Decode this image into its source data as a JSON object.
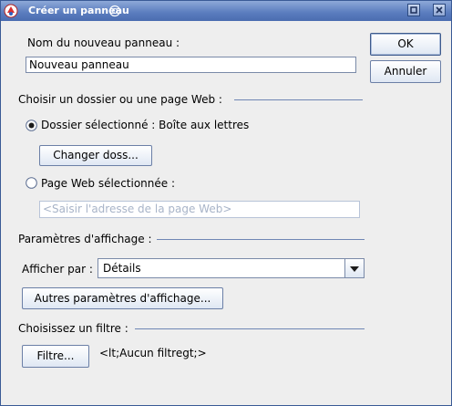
{
  "window": {
    "title": "Créer un panneau"
  },
  "name_section": {
    "label": "Nom du nouveau panneau :",
    "value": "Nouveau panneau"
  },
  "buttons": {
    "ok": "OK",
    "cancel": "Annuler"
  },
  "location_section": {
    "heading": "Choisir un dossier ou une page Web :",
    "folder_option": {
      "label": "Dossier sélectionné : Boîte aux lettres",
      "selected": true
    },
    "change_folder_button": "Changer doss...",
    "web_option": {
      "label": "Page Web sélectionnée :",
      "selected": false
    },
    "web_address_placeholder": "<Saisir l'adresse de la page Web>"
  },
  "display_section": {
    "heading": "Paramètres d'affichage :",
    "display_by_label": "Afficher par :",
    "display_by_value": "Détails",
    "more_settings_button": "Autres paramètres d'affichage..."
  },
  "filter_section": {
    "heading": "Choisissez un filtre :",
    "filter_button": "Filtre...",
    "filter_value": "<lt;Aucun filtregt;>"
  },
  "colors": {
    "titlebar": "#5d7fc0",
    "separator": "#6f86b4",
    "background": "#eeeeee"
  }
}
